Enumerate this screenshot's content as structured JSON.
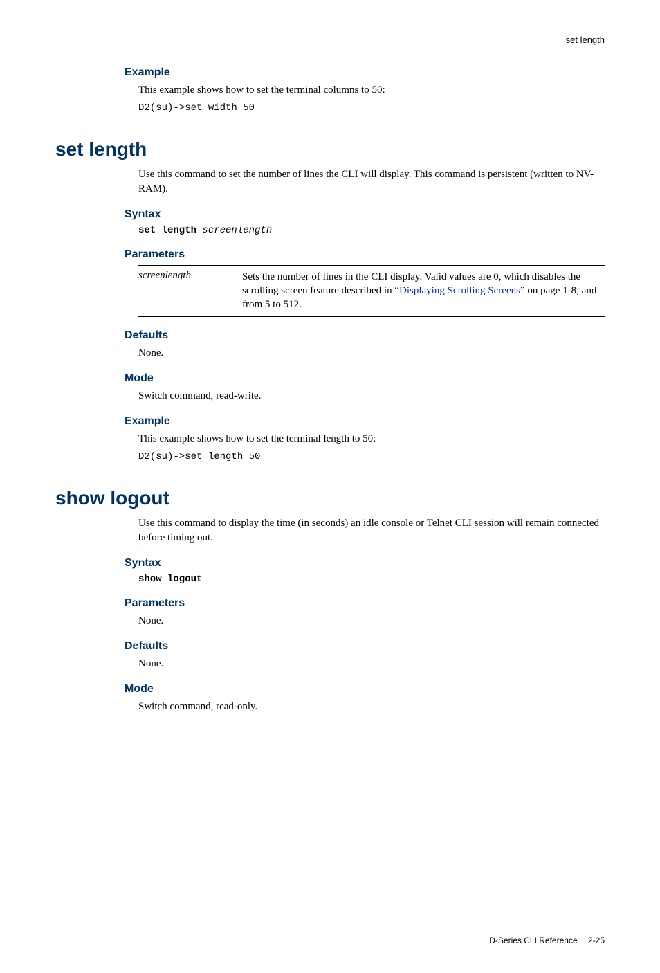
{
  "header": {
    "title": "set length"
  },
  "s1": {
    "example_h": "Example",
    "example_text": "This example shows how to set the terminal columns to 50:",
    "example_code": "D2(su)->set width 50"
  },
  "s2": {
    "title": "set length",
    "intro": "Use this command to set the number of lines the CLI will display. This command is persistent (written to NV-RAM).",
    "syntax_h": "Syntax",
    "syntax_cmd": "set length",
    "syntax_arg": "screenlength",
    "params_h": "Parameters",
    "param_name": "screenlength",
    "param_desc_a": "Sets the number of lines in the CLI display. Valid values are 0, which disables the scrolling screen feature described in “",
    "param_link": "Displaying Scrolling Screens",
    "param_desc_b": "” on page 1-8, and from 5 to 512.",
    "defaults_h": "Defaults",
    "defaults_text": "None.",
    "mode_h": "Mode",
    "mode_text": "Switch command, read-write.",
    "example_h": "Example",
    "example_text": "This example shows how to set the terminal length to 50:",
    "example_code": "D2(su)->set length 50"
  },
  "s3": {
    "title": "show logout",
    "intro": "Use this command to display the time (in seconds) an idle console or Telnet CLI session will remain connected before timing out.",
    "syntax_h": "Syntax",
    "syntax_cmd": "show logout",
    "params_h": "Parameters",
    "params_text": "None.",
    "defaults_h": "Defaults",
    "defaults_text": "None.",
    "mode_h": "Mode",
    "mode_text": "Switch command, read-only."
  },
  "footer": {
    "doc": "D-Series CLI Reference",
    "page": "2-25"
  }
}
